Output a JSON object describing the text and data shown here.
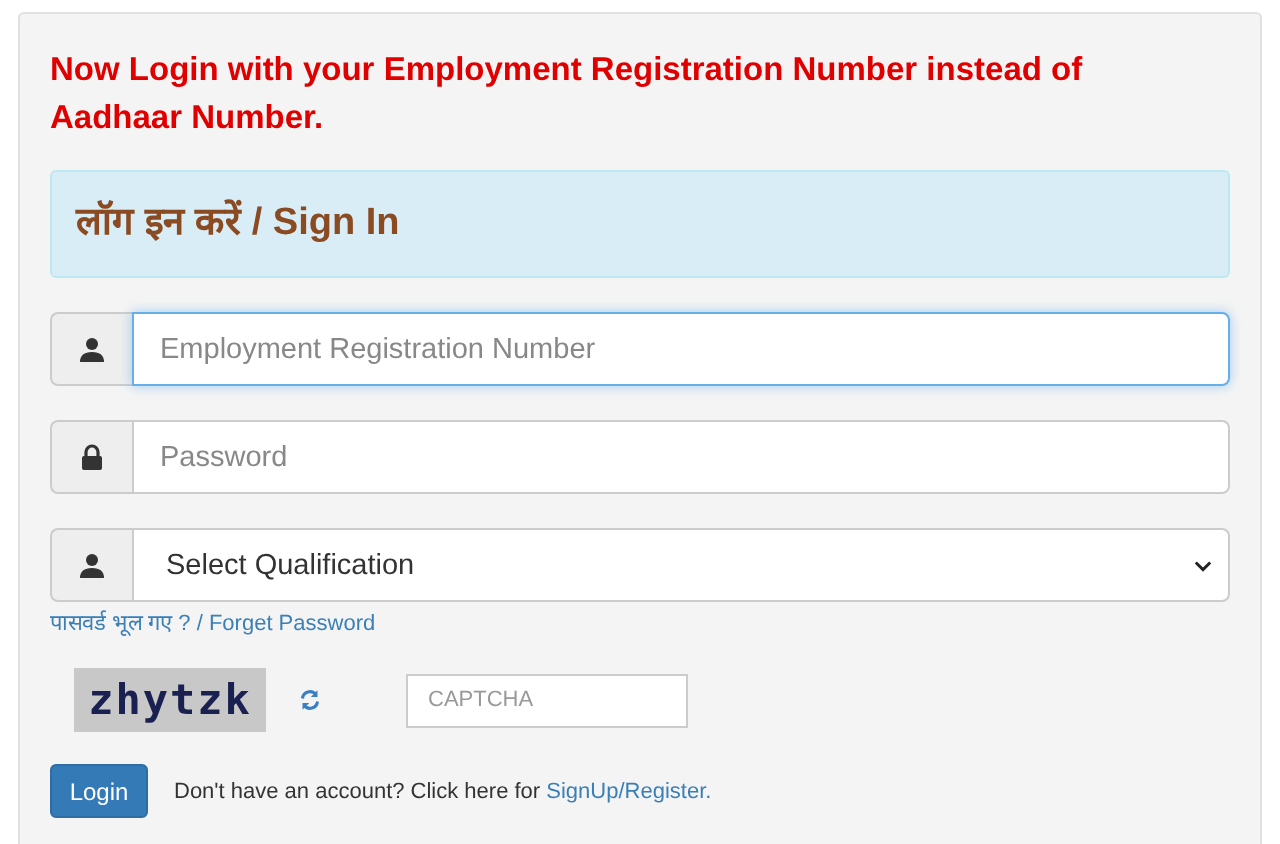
{
  "notice": "Now Login with your Employment Registration Number instead of Aadhaar Number.",
  "heading": "लॉग इन करें / Sign In",
  "fields": [
    {
      "kind": "account",
      "placeholder": "Employment Registration Number",
      "focused": true
    },
    {
      "kind": "password",
      "placeholder": "Password",
      "focused": false
    },
    {
      "kind": "select",
      "value": "Select Qualification",
      "focused": false
    }
  ],
  "forgot_link": "पासवर्ड भूल गए ? / Forget Password",
  "captcha": {
    "code": "zhytzk",
    "placeholder": "CAPTCHA"
  },
  "login_button": "Login",
  "signup": {
    "text": "Don't have an account? Click here for",
    "link": "SignUp/Register."
  }
}
